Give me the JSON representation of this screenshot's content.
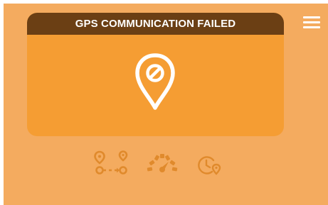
{
  "app": {
    "background_color": "#f4ab5f",
    "accent_color": "#f59d33",
    "header_color": "#6b3f14"
  },
  "header": {
    "menu_icon": "hamburger-menu-icon"
  },
  "alert": {
    "title": "GPS COMMUNICATION FAILED",
    "icon": "location-pin-blocked-icon"
  },
  "bottom_nav": {
    "items": [
      {
        "icon": "route-icon"
      },
      {
        "icon": "speedometer-icon"
      },
      {
        "icon": "history-location-icon"
      }
    ]
  }
}
